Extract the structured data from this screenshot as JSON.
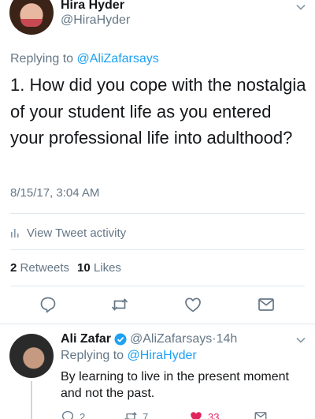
{
  "main_tweet": {
    "author_name": "Hira Hyder",
    "author_handle": "@HiraHyder",
    "replying_prefix": "Replying to",
    "replying_to": "@AliZafarsays",
    "text": "1. How did you cope with the nostalgia of your student life as you entered your professional life into adulthood?",
    "timestamp": "8/15/17, 3:04 AM",
    "activity_label": "View Tweet activity",
    "retweets_count": "2",
    "retweets_label": "Retweets",
    "likes_count": "10",
    "likes_label": "Likes",
    "icons": [
      "reply-icon",
      "retweet-icon",
      "like-icon",
      "direct-message-icon"
    ]
  },
  "reply_tweet": {
    "author_name": "Ali Zafar",
    "author_handle": "@AliZafarsays",
    "separator": "·",
    "time": "14h",
    "replying_prefix": "Replying to",
    "replying_to": "@HiraHyder",
    "text": "By learning to live in the present moment and not the past.",
    "reply_count": "2",
    "retweet_count": "7",
    "like_count": "33"
  },
  "colors": {
    "link": "#1da1f2",
    "secondary_text": "#657786",
    "divider": "#e1e8ed",
    "liked": "#e0245e",
    "verified": "#1da1f2"
  }
}
